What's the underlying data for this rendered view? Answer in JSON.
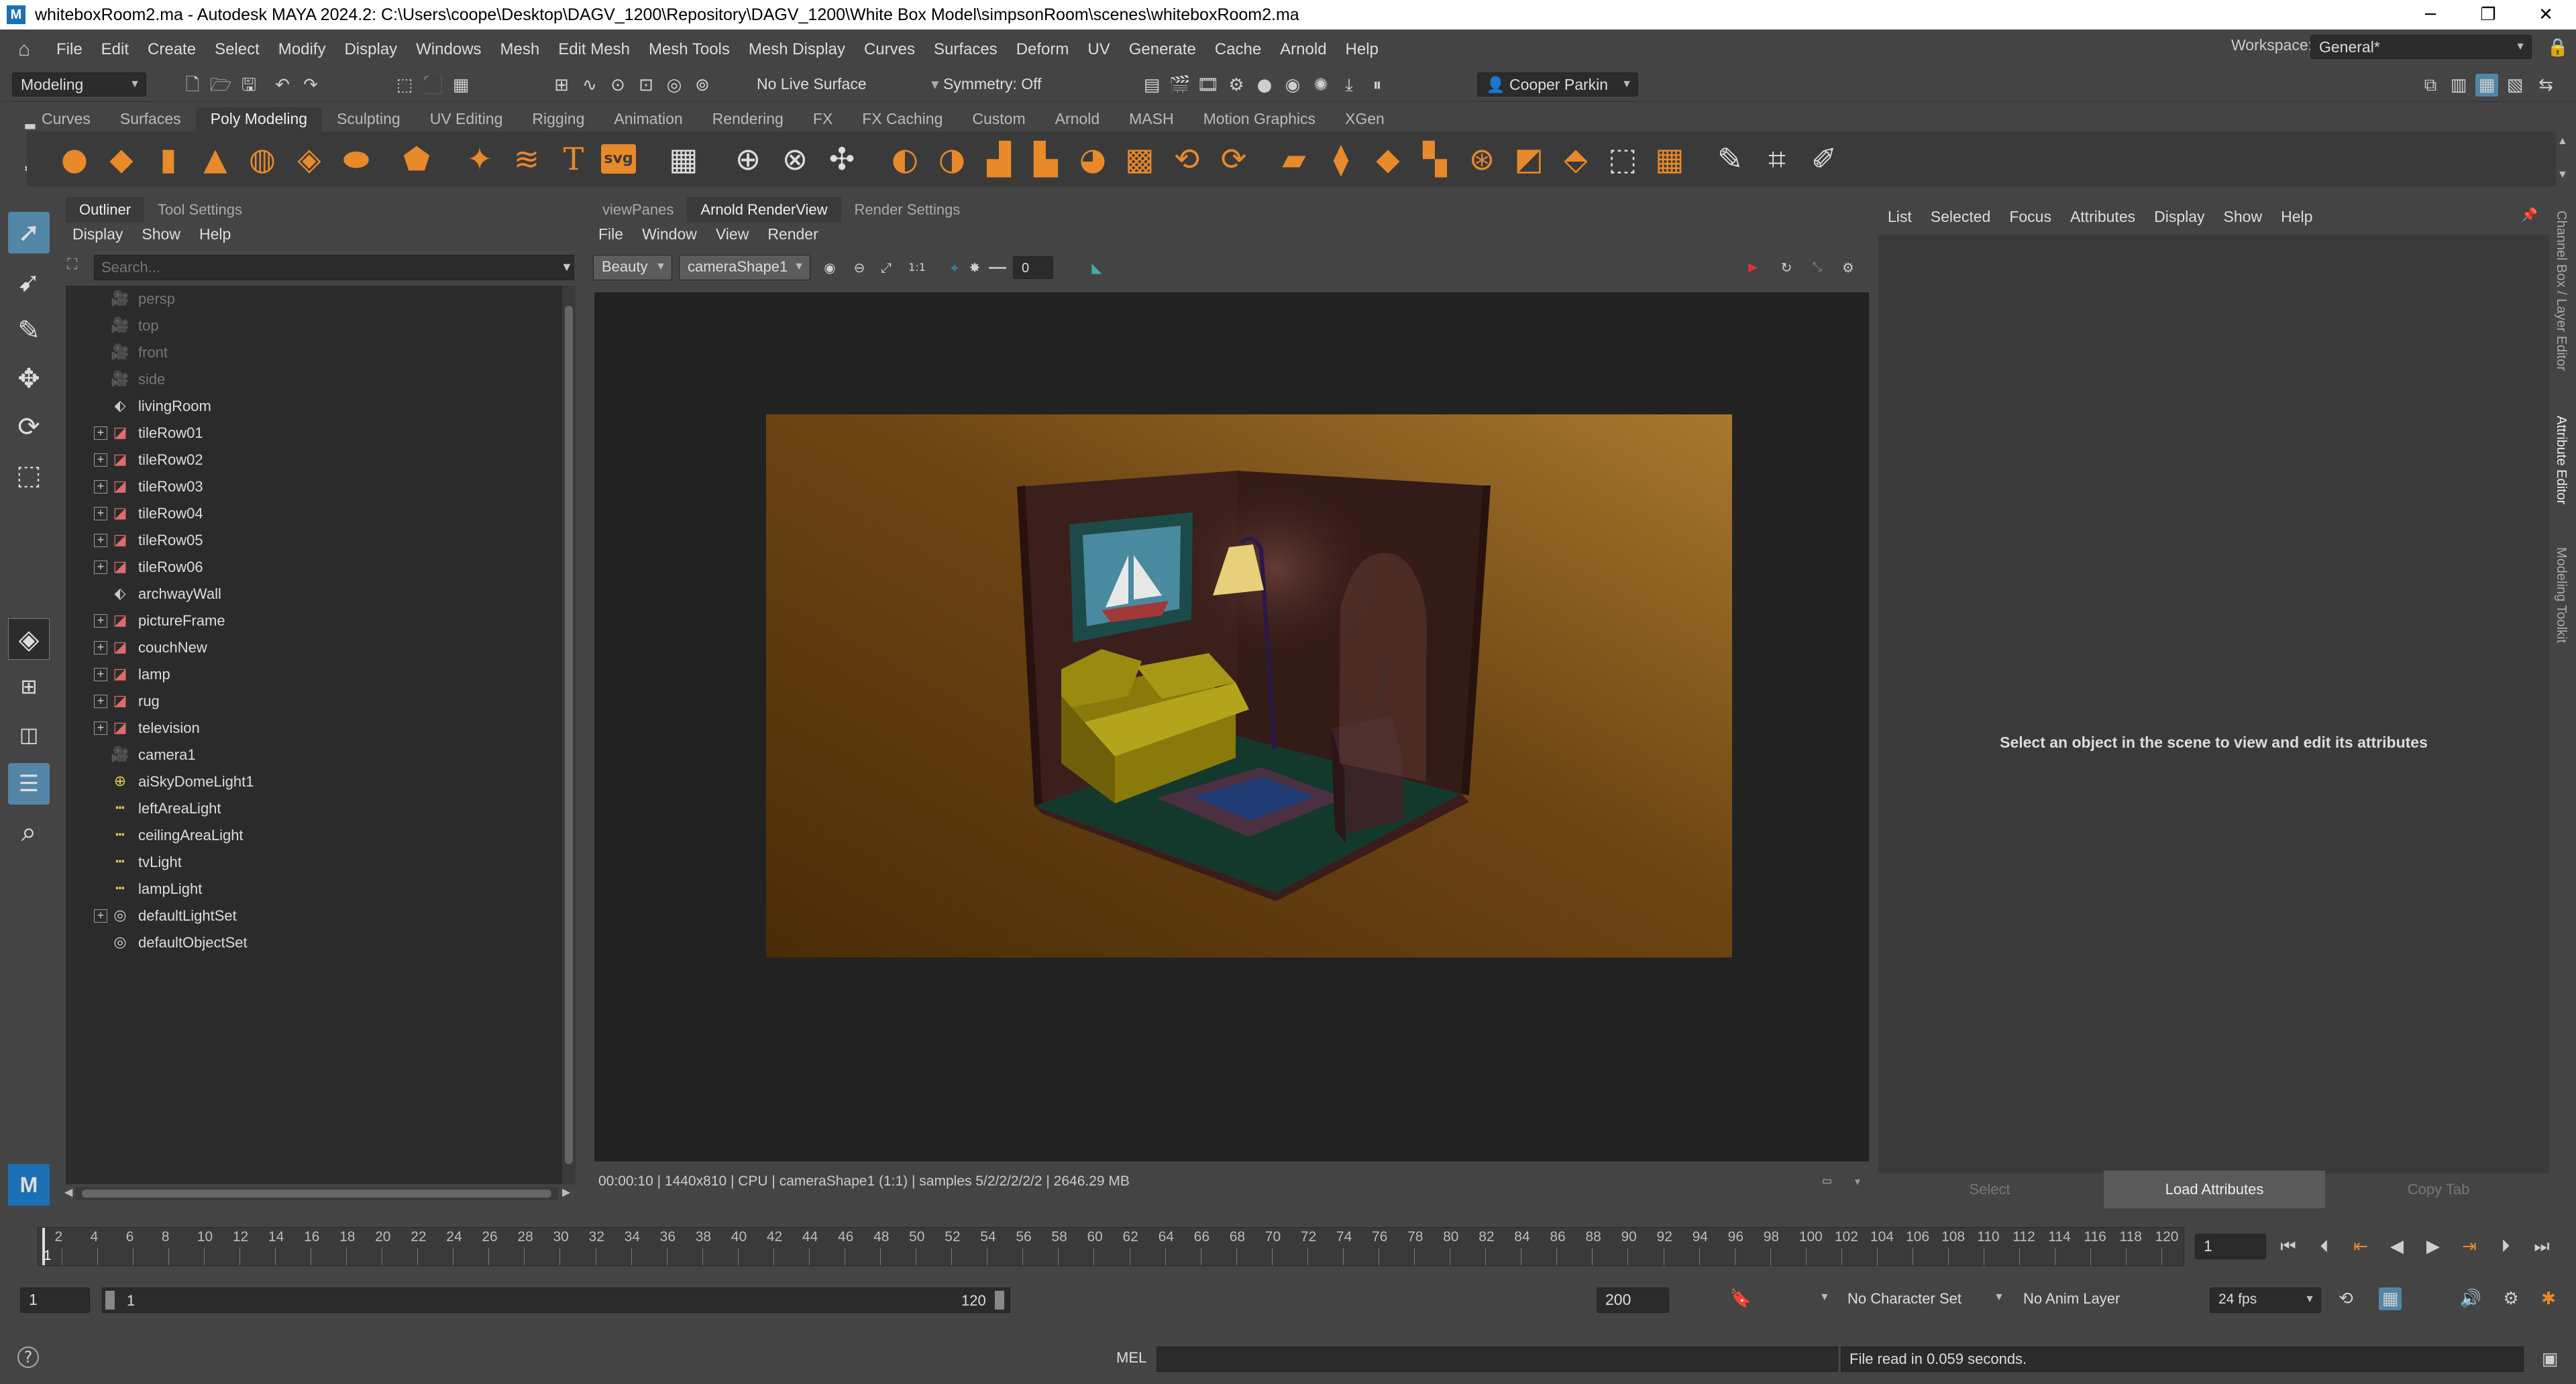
{
  "window": {
    "title": "whiteboxRoom2.ma - Autodesk MAYA 2024.2: C:\\Users\\coope\\Desktop\\DAGV_1200\\Repository\\DAGV_1200\\White Box Model\\simpsonRoom\\scenes\\whiteboxRoom2.ma",
    "app_icon_text": "M"
  },
  "menubar": {
    "items": [
      "File",
      "Edit",
      "Create",
      "Select",
      "Modify",
      "Display",
      "Windows",
      "Mesh",
      "Edit Mesh",
      "Mesh Tools",
      "Mesh Display",
      "Curves",
      "Surfaces",
      "Deform",
      "UV",
      "Generate",
      "Cache",
      "Arnold",
      "Help"
    ],
    "workspace_label": "Workspace:",
    "workspace_value": "General*"
  },
  "statusline": {
    "menuset": "Modeling",
    "live_surface": "No Live Surface",
    "symmetry": "Symmetry: Off",
    "user": "Cooper Parkin"
  },
  "shelf": {
    "tabs": [
      "Curves",
      "Surfaces",
      "Poly Modeling",
      "Sculpting",
      "UV Editing",
      "Rigging",
      "Animation",
      "Rendering",
      "FX",
      "FX Caching",
      "Custom",
      "Arnold",
      "MASH",
      "Motion Graphics",
      "XGen"
    ],
    "active_tab": "Poly Modeling",
    "text_icon": "T",
    "svg_icon": "svg"
  },
  "outliner": {
    "tabs": [
      "Outliner",
      "Tool Settings"
    ],
    "menu": [
      "Display",
      "Show",
      "Help"
    ],
    "search_placeholder": "Search...",
    "items": [
      {
        "name": "persp",
        "type": "camera",
        "dim": true,
        "expand": false
      },
      {
        "name": "top",
        "type": "camera",
        "dim": true,
        "expand": false
      },
      {
        "name": "front",
        "type": "camera",
        "dim": true,
        "expand": false
      },
      {
        "name": "side",
        "type": "camera",
        "dim": true,
        "expand": false
      },
      {
        "name": "livingRoom",
        "type": "group",
        "dim": false,
        "expand": false
      },
      {
        "name": "tileRow01",
        "type": "mesh",
        "dim": false,
        "expand": true
      },
      {
        "name": "tileRow02",
        "type": "mesh",
        "dim": false,
        "expand": true
      },
      {
        "name": "tileRow03",
        "type": "mesh",
        "dim": false,
        "expand": true
      },
      {
        "name": "tileRow04",
        "type": "mesh",
        "dim": false,
        "expand": true
      },
      {
        "name": "tileRow05",
        "type": "mesh",
        "dim": false,
        "expand": true
      },
      {
        "name": "tileRow06",
        "type": "mesh",
        "dim": false,
        "expand": true
      },
      {
        "name": "archwayWall",
        "type": "group",
        "dim": false,
        "expand": false
      },
      {
        "name": "pictureFrame",
        "type": "mesh",
        "dim": false,
        "expand": true
      },
      {
        "name": "couchNew",
        "type": "mesh",
        "dim": false,
        "expand": true
      },
      {
        "name": "lamp",
        "type": "mesh",
        "dim": false,
        "expand": true
      },
      {
        "name": "rug",
        "type": "mesh",
        "dim": false,
        "expand": true
      },
      {
        "name": "television",
        "type": "mesh",
        "dim": false,
        "expand": true
      },
      {
        "name": "camera1",
        "type": "camera",
        "dim": false,
        "expand": false
      },
      {
        "name": "aiSkyDomeLight1",
        "type": "dome",
        "dim": false,
        "expand": false
      },
      {
        "name": "leftAreaLight",
        "type": "light",
        "dim": false,
        "expand": false
      },
      {
        "name": "ceilingAreaLight",
        "type": "light",
        "dim": false,
        "expand": false
      },
      {
        "name": "tvLight",
        "type": "light",
        "dim": false,
        "expand": false
      },
      {
        "name": "lampLight",
        "type": "light",
        "dim": false,
        "expand": false
      },
      {
        "name": "defaultLightSet",
        "type": "set",
        "dim": false,
        "expand": true
      },
      {
        "name": "defaultObjectSet",
        "type": "set",
        "dim": false,
        "expand": false
      }
    ]
  },
  "renderview": {
    "tabs": [
      "viewPanes",
      "Arnold RenderView",
      "Render Settings"
    ],
    "active_tab": "Arnold RenderView",
    "menu": [
      "File",
      "Window",
      "View",
      "Render"
    ],
    "aov": "Beauty",
    "camera": "cameraShape1",
    "ratio_label": "1:1",
    "exposure": "0",
    "status": "00:00:10 | 1440x810 | CPU | cameraShape1 (1:1) | samples 5/2/2/2/2/2 | 2646.29 MB"
  },
  "attribute_editor": {
    "menu": [
      "List",
      "Selected",
      "Focus",
      "Attributes",
      "Display",
      "Show",
      "Help"
    ],
    "message": "Select an object in the scene to view and edit its attributes",
    "buttons": {
      "select": "Select",
      "load": "Load Attributes",
      "copy": "Copy Tab"
    }
  },
  "side_tabs": [
    "Channel Box / Layer Editor",
    "Attribute Editor",
    "Modeling Toolkit"
  ],
  "timeline": {
    "ticks": [
      "2",
      "4",
      "6",
      "8",
      "10",
      "12",
      "14",
      "16",
      "18",
      "20",
      "22",
      "24",
      "26",
      "28",
      "30",
      "32",
      "34",
      "36",
      "38",
      "40",
      "42",
      "44",
      "46",
      "48",
      "50",
      "52",
      "54",
      "56",
      "58",
      "60",
      "62",
      "64",
      "66",
      "68",
      "70",
      "72",
      "74",
      "76",
      "78",
      "80",
      "82",
      "84",
      "86",
      "88",
      "90",
      "92",
      "94",
      "96",
      "98",
      "100",
      "102",
      "104",
      "106",
      "108",
      "110",
      "112",
      "114",
      "116",
      "118",
      "120"
    ],
    "current_frame_marker": "1",
    "current_frame": "1"
  },
  "range": {
    "start": "1",
    "inner_start": "1",
    "inner_end": "120",
    "end": "200",
    "character_set": "No Character Set",
    "anim_layer": "No Anim Layer",
    "fps": "24 fps"
  },
  "commandline": {
    "lang": "MEL",
    "feedback": "File read in  0.059 seconds."
  },
  "colors": {
    "accent": "#5285a6",
    "shelf_icon": "#e8892a",
    "panel_bg": "#444444",
    "field_bg": "#2b2b2b"
  }
}
